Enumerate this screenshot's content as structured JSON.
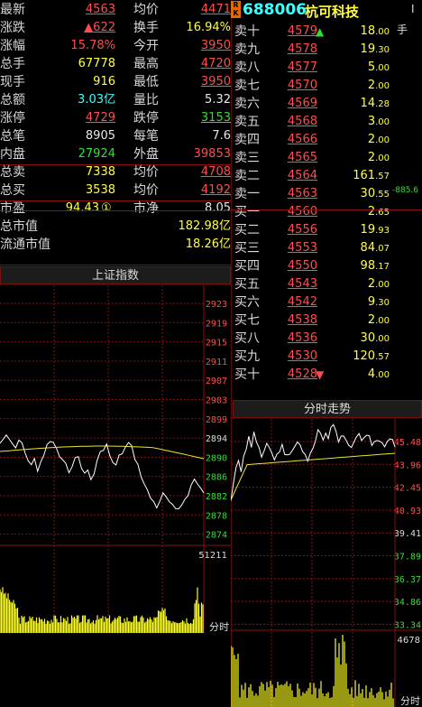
{
  "quote": {
    "latest": {
      "label": "最新",
      "value": "4563"
    },
    "change": {
      "label": "涨跌",
      "value": "▲622"
    },
    "pct": {
      "label": "涨幅",
      "value": "15.78%"
    },
    "total_hands": {
      "label": "总手",
      "value": "67778"
    },
    "now_hands": {
      "label": "现手",
      "value": "916"
    },
    "amount": {
      "label": "总额",
      "value": "3.03亿"
    },
    "limit_up": {
      "label": "涨停",
      "value": "4729"
    },
    "total_trades": {
      "label": "总笔",
      "value": "8905"
    },
    "inner": {
      "label": "内盘",
      "value": "27924"
    },
    "total_sell": {
      "label": "总卖",
      "value": "7338"
    },
    "total_buy": {
      "label": "总买",
      "value": "3538"
    },
    "pe": {
      "label": "市盈",
      "value": "94.43"
    },
    "market_cap": {
      "label": "总市值",
      "value": "182.98亿"
    },
    "float_cap": {
      "label": "流通市值",
      "value": "18.26亿"
    },
    "avg": {
      "label": "均价",
      "value": "4471"
    },
    "turnover": {
      "label": "换手",
      "value": "16.94%"
    },
    "open": {
      "label": "今开",
      "value": "3950"
    },
    "high": {
      "label": "最高",
      "value": "4720"
    },
    "low": {
      "label": "最低",
      "value": "3950"
    },
    "vol_ratio": {
      "label": "量比",
      "value": "5.32"
    },
    "limit_down": {
      "label": "跌停",
      "value": "3153"
    },
    "per_trade": {
      "label": "每笔",
      "value": "7.6"
    },
    "outer": {
      "label": "外盘",
      "value": "39853"
    },
    "sell_avg": {
      "label": "均价",
      "value": "4708"
    },
    "buy_avg": {
      "label": "均价",
      "value": "4192"
    },
    "pb": {
      "label": "市净",
      "value": "8.05"
    },
    "info_icon": "①"
  },
  "stock": {
    "badge": "R K",
    "code": "688006",
    "name": "杭可科技",
    "hand_label": "手",
    "corner_label": "I"
  },
  "orderbook": {
    "asks": [
      {
        "label": "卖十",
        "price": "4579",
        "vol_int": "18",
        "vol_dec": ".00",
        "arrow": "▲"
      },
      {
        "label": "卖九",
        "price": "4578",
        "vol_int": "19",
        "vol_dec": ".30"
      },
      {
        "label": "卖八",
        "price": "4577",
        "vol_int": "5",
        "vol_dec": ".00"
      },
      {
        "label": "卖七",
        "price": "4570",
        "vol_int": "2",
        "vol_dec": ".00"
      },
      {
        "label": "卖六",
        "price": "4569",
        "vol_int": "14",
        "vol_dec": ".28"
      },
      {
        "label": "卖五",
        "price": "4568",
        "vol_int": "3",
        "vol_dec": ".00"
      },
      {
        "label": "卖四",
        "price": "4566",
        "vol_int": "2",
        "vol_dec": ".00"
      },
      {
        "label": "卖三",
        "price": "4565",
        "vol_int": "2",
        "vol_dec": ".00"
      },
      {
        "label": "卖二",
        "price": "4564",
        "vol_int": "161",
        "vol_dec": ".57"
      },
      {
        "label": "卖一",
        "price": "4563",
        "vol_int": "30",
        "vol_dec": ".55",
        "extra": "-885.6"
      }
    ],
    "bids": [
      {
        "label": "买一",
        "price": "4560",
        "vol_int": "2",
        "vol_dec": ".65"
      },
      {
        "label": "买二",
        "price": "4556",
        "vol_int": "19",
        "vol_dec": ".93"
      },
      {
        "label": "买三",
        "price": "4553",
        "vol_int": "84",
        "vol_dec": ".07"
      },
      {
        "label": "买四",
        "price": "4550",
        "vol_int": "98",
        "vol_dec": ".17"
      },
      {
        "label": "买五",
        "price": "4543",
        "vol_int": "2",
        "vol_dec": ".00"
      },
      {
        "label": "买六",
        "price": "4542",
        "vol_int": "9",
        "vol_dec": ".30"
      },
      {
        "label": "买七",
        "price": "4538",
        "vol_int": "2",
        "vol_dec": ".00"
      },
      {
        "label": "买八",
        "price": "4536",
        "vol_int": "30",
        "vol_dec": ".00"
      },
      {
        "label": "买九",
        "price": "4530",
        "vol_int": "120",
        "vol_dec": ".57"
      },
      {
        "label": "买十",
        "price": "4528",
        "vol_int": "4",
        "vol_dec": ".00",
        "arrow": "▼"
      }
    ]
  },
  "index_panel": {
    "title": "上证指数",
    "axis": [
      "2923",
      "2919",
      "2915",
      "2911",
      "2907",
      "2903",
      "2899",
      "2894",
      "2890",
      "2886",
      "2882",
      "2878",
      "2874"
    ],
    "vol_max": "51211",
    "footer": "分时"
  },
  "intraday_panel": {
    "title": "分时走势",
    "axis": [
      "45.48",
      "43.96",
      "42.45",
      "40.93",
      "39.41",
      "37.89",
      "36.37",
      "34.86",
      "33.34"
    ],
    "vol_max": "4678",
    "footer": "分时"
  },
  "colors": {
    "up": "#ff4d4d",
    "down": "#30e030",
    "grid": "#8a1010",
    "price_line": "#ffffff",
    "avg_line": "#e8e830"
  }
}
